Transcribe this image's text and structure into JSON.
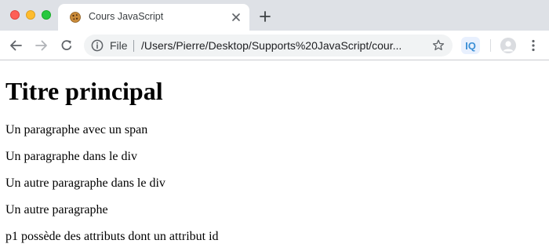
{
  "window": {
    "tab": {
      "title": "Cours JavaScript",
      "favicon": "cookie-icon"
    },
    "traffic_lights": {
      "close_color": "#fe5f57",
      "minimize_color": "#febc2e",
      "maximize_color": "#28c840"
    }
  },
  "toolbar": {
    "scheme_label": "File",
    "url": "/Users/Pierre/Desktop/Supports%20JavaScript/cour...",
    "extension_label": "IQ",
    "icons": [
      "back-arrow-icon",
      "forward-arrow-icon",
      "reload-icon",
      "info-icon",
      "star-icon",
      "profile-icon",
      "more-vertical-icon"
    ]
  },
  "page": {
    "heading": "Titre principal",
    "paragraphs": [
      "Un paragraphe avec un span",
      "Un paragraphe dans le div",
      "Un autre paragraphe dans le div",
      "Un autre paragraphe",
      "p1 possède des attributs dont un attribut id"
    ]
  }
}
